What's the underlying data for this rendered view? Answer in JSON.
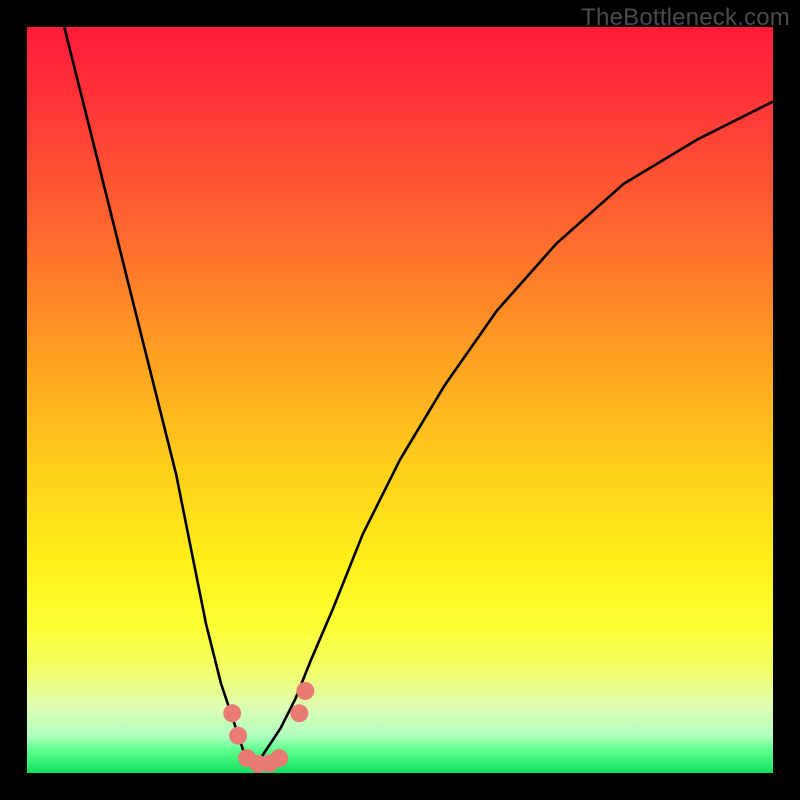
{
  "watermark": "TheBottleneck.com",
  "gradient": {
    "stops": [
      {
        "pct": 0,
        "color": "#ff1a3a"
      },
      {
        "pct": 12,
        "color": "#ff3a38"
      },
      {
        "pct": 28,
        "color": "#ff6a2e"
      },
      {
        "pct": 45,
        "color": "#ffa321"
      },
      {
        "pct": 60,
        "color": "#ffd21a"
      },
      {
        "pct": 72,
        "color": "#fff01a"
      },
      {
        "pct": 80,
        "color": "#fcff33"
      },
      {
        "pct": 86,
        "color": "#f2ff66"
      },
      {
        "pct": 91,
        "color": "#e0ffb0"
      },
      {
        "pct": 95,
        "color": "#b0ffc0"
      },
      {
        "pct": 97,
        "color": "#5aff8a"
      },
      {
        "pct": 100,
        "color": "#10e060"
      }
    ]
  },
  "chart_data": {
    "type": "line",
    "title": "",
    "xlabel": "",
    "ylabel": "",
    "xlim": [
      0,
      100
    ],
    "ylim": [
      0,
      100
    ],
    "note": "Approximate V-shaped bottleneck curve; values are estimated from pixels (no axis ticks present).",
    "series": [
      {
        "name": "bottleneck-curve",
        "x": [
          5,
          8,
          11,
          14,
          17,
          20,
          22,
          24,
          26,
          28,
          29,
          30,
          31,
          32,
          34,
          36,
          38,
          41,
          45,
          50,
          56,
          63,
          71,
          80,
          90,
          100
        ],
        "y": [
          100,
          88,
          76,
          64,
          52,
          40,
          30,
          20,
          12,
          6,
          3,
          1.5,
          1.5,
          3,
          6,
          10,
          15,
          22,
          32,
          42,
          52,
          62,
          71,
          79,
          85,
          90
        ]
      }
    ],
    "markers": [
      {
        "name": "cluster-left-upper",
        "x": 27.5,
        "y": 8,
        "color": "#e97b74",
        "size": 9
      },
      {
        "name": "cluster-left-lower",
        "x": 28.3,
        "y": 5,
        "color": "#e97b74",
        "size": 9
      },
      {
        "name": "cluster-min-1",
        "x": 29.5,
        "y": 2,
        "color": "#e97b74",
        "size": 9
      },
      {
        "name": "cluster-min-2",
        "x": 31.0,
        "y": 1.2,
        "color": "#e97b74",
        "size": 9
      },
      {
        "name": "cluster-min-3",
        "x": 32.5,
        "y": 1.3,
        "color": "#e97b74",
        "size": 9
      },
      {
        "name": "cluster-min-4",
        "x": 33.8,
        "y": 2,
        "color": "#e97b74",
        "size": 9
      },
      {
        "name": "cluster-right-lower",
        "x": 36.5,
        "y": 8,
        "color": "#e97b74",
        "size": 9
      },
      {
        "name": "cluster-right-upper",
        "x": 37.3,
        "y": 11,
        "color": "#e97b74",
        "size": 9
      }
    ]
  }
}
